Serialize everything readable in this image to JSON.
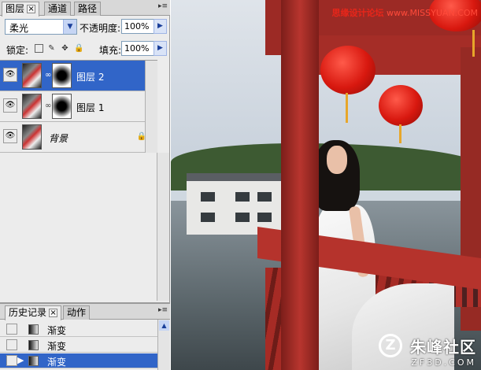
{
  "layers_panel": {
    "tabs": [
      {
        "label": "图层",
        "active": true,
        "closable": true
      },
      {
        "label": "通道",
        "active": false
      },
      {
        "label": "路径",
        "active": false
      }
    ],
    "blend_mode": "柔光",
    "opacity_label": "不透明度:",
    "opacity_value": "100%",
    "lock_label": "锁定:",
    "fill_label": "填充:",
    "fill_value": "100%",
    "layers": [
      {
        "name": "图层 2",
        "selected": true,
        "has_mask": true
      },
      {
        "name": "图层 1",
        "selected": false,
        "has_mask": true
      },
      {
        "name": "背景",
        "selected": false,
        "has_mask": false,
        "locked": true
      }
    ]
  },
  "history_panel": {
    "tabs": [
      {
        "label": "历史记录",
        "active": true,
        "closable": true
      },
      {
        "label": "动作",
        "active": false
      }
    ],
    "items": [
      {
        "label": "渐变",
        "selected": false
      },
      {
        "label": "渐变",
        "selected": false
      },
      {
        "label": "渐变",
        "selected": true
      }
    ]
  },
  "canvas": {
    "watermark_top_cn": "思缘设计论坛",
    "watermark_top_url": "www.MISSYUAN.COM",
    "watermark_bottom_cn": "朱峰社区",
    "watermark_bottom_en": "ZF3D.COM",
    "watermark_logo": "Z"
  },
  "colors": {
    "selection": "#3165c8",
    "panel_bg": "#ececec",
    "pillar_red": "#b8352e"
  }
}
